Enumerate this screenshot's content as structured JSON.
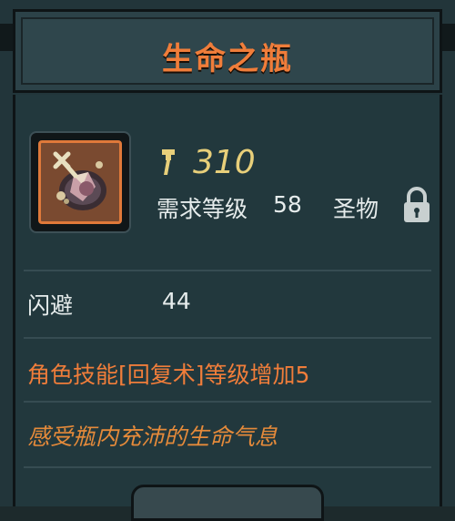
{
  "header": {
    "title": "生命之瓶"
  },
  "item": {
    "icon": "potion-bottle-icon",
    "power_icon": "sword-power-icon",
    "power": "310",
    "required_level_label": "需求等级",
    "required_level": "58",
    "rarity": "圣物",
    "lock_icon": "padlock-icon"
  },
  "stats": [
    {
      "name": "闪避",
      "value": "44"
    }
  ],
  "effect": "角色技能[回复术]等级增加5",
  "flavor": "感受瓶内充沛的生命气息",
  "colors": {
    "title": "#f07d3a",
    "power": "#e8cf7a",
    "effect": "#f07d3a",
    "flavor": "#e58a3a",
    "panel": "#22383d"
  }
}
